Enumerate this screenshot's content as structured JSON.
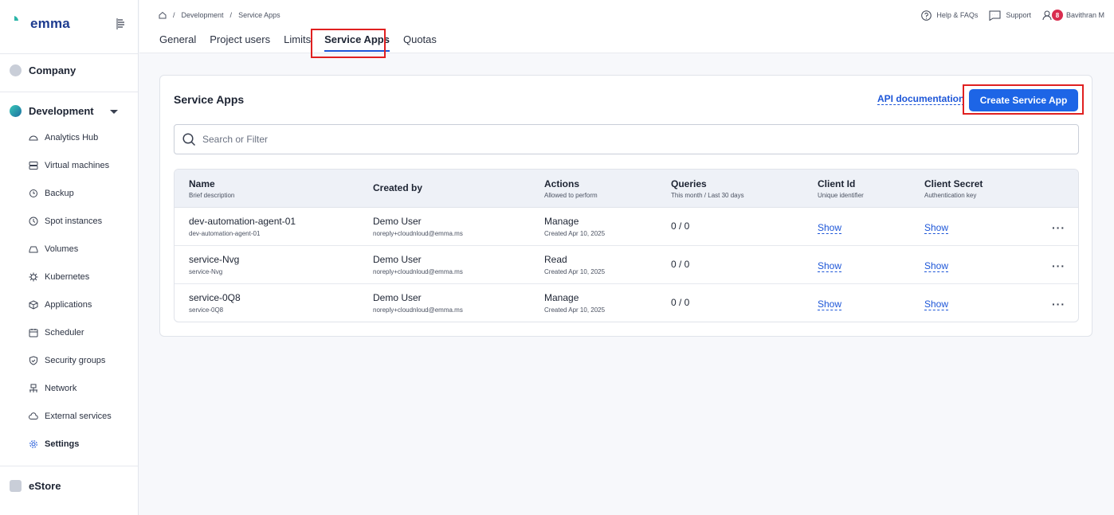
{
  "app": {
    "name": "emma"
  },
  "sidebar": {
    "groups": [
      {
        "label": "Company",
        "color": "#c9ced8"
      },
      {
        "label": "Development",
        "color": "#2bb5a8"
      },
      {
        "label": "eStore",
        "color": "#c9ced8"
      }
    ],
    "items": [
      {
        "label": "Analytics Hub",
        "icon": "analytics-icon"
      },
      {
        "label": "Virtual machines",
        "icon": "server-icon"
      },
      {
        "label": "Backup",
        "icon": "backup-icon"
      },
      {
        "label": "Spot instances",
        "icon": "clock-icon"
      },
      {
        "label": "Volumes",
        "icon": "disk-icon"
      },
      {
        "label": "Kubernetes",
        "icon": "kubernetes-icon"
      },
      {
        "label": "Applications",
        "icon": "cube-icon"
      },
      {
        "label": "Scheduler",
        "icon": "calendar-icon"
      },
      {
        "label": "Security groups",
        "icon": "shield-icon"
      },
      {
        "label": "Network",
        "icon": "network-icon"
      },
      {
        "label": "External services",
        "icon": "cloud-icon"
      },
      {
        "label": "Settings",
        "icon": "gear-icon",
        "active": true
      }
    ]
  },
  "breadcrumb": {
    "sep": "/",
    "items": [
      "Development",
      "Service Apps"
    ]
  },
  "tabs": [
    "General",
    "Project users",
    "Limits",
    "Service Apps",
    "Quotas"
  ],
  "header": {
    "help": "Help & FAQs",
    "support": "Support",
    "badge": "8",
    "user": "Bavithran M"
  },
  "card": {
    "title": "Service Apps",
    "api_link": "API documentation",
    "create_button": "Create Service App",
    "search_placeholder": "Search or Filter"
  },
  "table": {
    "columns": [
      {
        "title": "Name",
        "sub": "Brief description"
      },
      {
        "title": "Created by",
        "sub": ""
      },
      {
        "title": "Actions",
        "sub": "Allowed to perform"
      },
      {
        "title": "Queries",
        "sub": "This month / Last 30 days"
      },
      {
        "title": "Client Id",
        "sub": "Unique identifier"
      },
      {
        "title": "Client Secret",
        "sub": "Authentication key"
      }
    ],
    "rows": [
      {
        "name": "dev-automation-agent-01",
        "desc": "dev-automation-agent-01",
        "user": "Demo User",
        "email": "noreply+cloudnloud@emma.ms",
        "action": "Manage",
        "created": "Created Apr 10, 2025",
        "queries": "0 / 0",
        "client_id": "Show",
        "client_secret": "Show"
      },
      {
        "name": "service-Nvg",
        "desc": "service-Nvg",
        "user": "Demo User",
        "email": "noreply+cloudnloud@emma.ms",
        "action": "Read",
        "created": "Created Apr 10, 2025",
        "queries": "0 / 0",
        "client_id": "Show",
        "client_secret": "Show"
      },
      {
        "name": "service-0Q8",
        "desc": "service-0Q8",
        "user": "Demo User",
        "email": "noreply+cloudnloud@emma.ms",
        "action": "Manage",
        "created": "Created Apr 10, 2025",
        "queries": "0 / 0",
        "client_id": "Show",
        "client_secret": "Show"
      }
    ]
  },
  "colors": {
    "accent": "#1d65e6",
    "highlight": "#e02020",
    "badge": "#d92d4f"
  }
}
